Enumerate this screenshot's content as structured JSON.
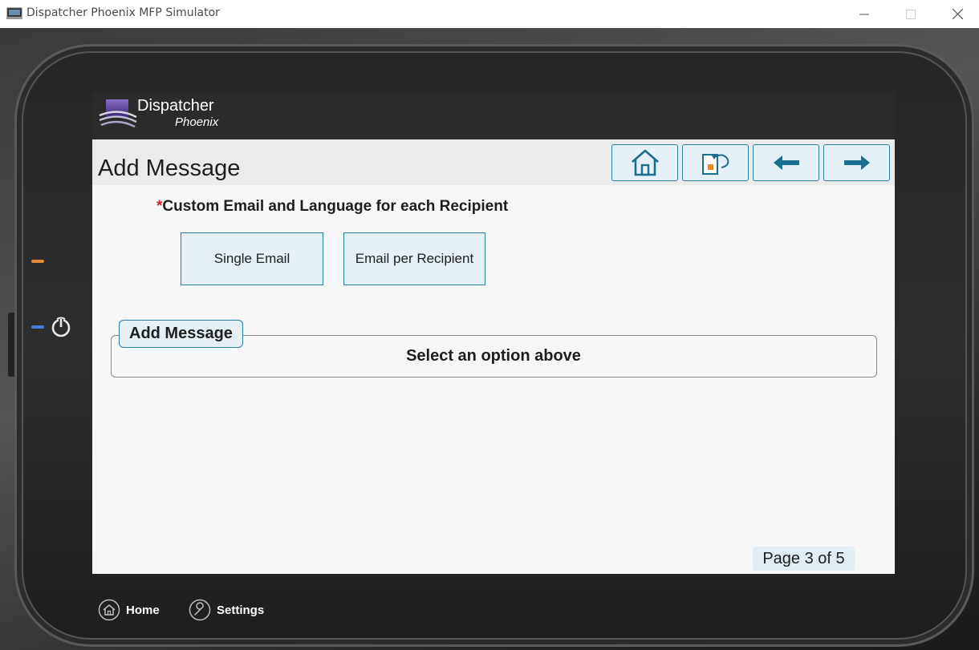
{
  "window": {
    "title": "Dispatcher Phoenix MFP Simulator",
    "controls": [
      "minimize-icon",
      "maximize-icon",
      "close-icon"
    ]
  },
  "brand": {
    "name": "Dispatcher",
    "subname": "Phoenix"
  },
  "header": {
    "title": "Add Message",
    "nav_buttons": [
      "home-icon",
      "restart-icon",
      "back-arrow-icon",
      "next-arrow-icon"
    ]
  },
  "question": {
    "required_marker": "*",
    "label": "Custom Email and Language for each Recipient"
  },
  "options": {
    "single_label": "Single Email",
    "per_recipient_label": "Email per Recipient"
  },
  "group": {
    "legend": "Add Message",
    "message": "Select an option above"
  },
  "pager": {
    "text": "Page 3 of 5"
  },
  "device_nav": {
    "home_label": "Home",
    "settings_label": "Settings"
  },
  "colors": {
    "accent": "#2a7f9e",
    "button_fill": "#e4f0f5",
    "brand_bar": "#2b2b2b",
    "required": "#d02020",
    "led_orange": "#e38a3c",
    "led_blue": "#4a7bd8"
  }
}
